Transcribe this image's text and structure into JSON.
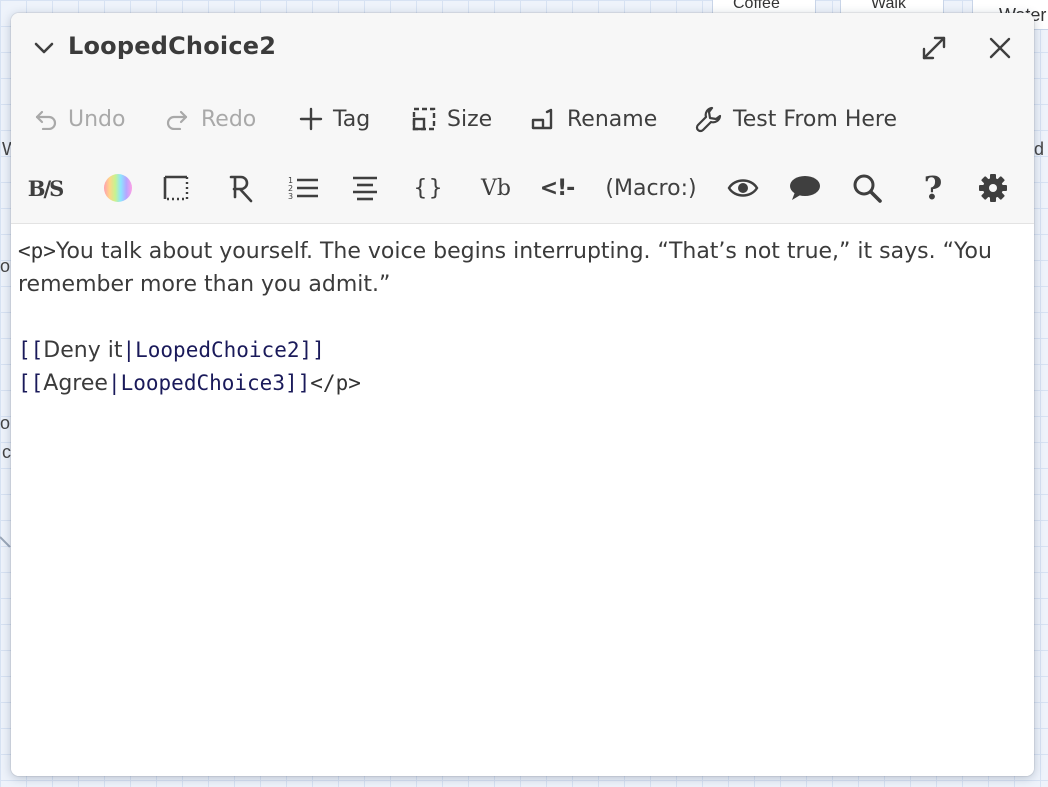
{
  "background": {
    "fragments": [
      "Coffee",
      "Walk",
      "Water",
      "W",
      "d",
      "o",
      "o",
      "c"
    ]
  },
  "dialog": {
    "title": "LoopedChoice2",
    "icons": {
      "collapse": "chevron-down-icon",
      "maximize": "maximize-icon",
      "close": "close-icon"
    }
  },
  "toolbar": {
    "undo": "Undo",
    "redo": "Redo",
    "tag": "Tag",
    "size": "Size",
    "rename": "Rename",
    "test_from_here": "Test From Here"
  },
  "format_toolbar": {
    "bold_strike": "B/S",
    "vb": "Vb",
    "braces": "{}",
    "comment_open": "<!-",
    "macro": "(Macro:)"
  },
  "editor": {
    "line1_tag_open": "<p>",
    "line1_text": "You talk about yourself. The voice begins interrupting. “That’s not true,” it says. “You",
    "line2_text": "remember more than you admit.”",
    "link1": {
      "open": "[[",
      "label": "Deny it",
      "separator": "|",
      "target": "LoopedChoice2",
      "close": "]]"
    },
    "link2": {
      "open": "[[",
      "label": "Agree",
      "separator": "|",
      "target": "LoopedChoice3",
      "close": "]]",
      "tag_close": "</p>"
    }
  },
  "colors": {
    "header_bg": "#f7f7f7",
    "text": "#3b3b3b",
    "disabled": "#a9a9a9",
    "link_target": "#1a1a5a",
    "canvas_bg": "#eef3fb"
  }
}
